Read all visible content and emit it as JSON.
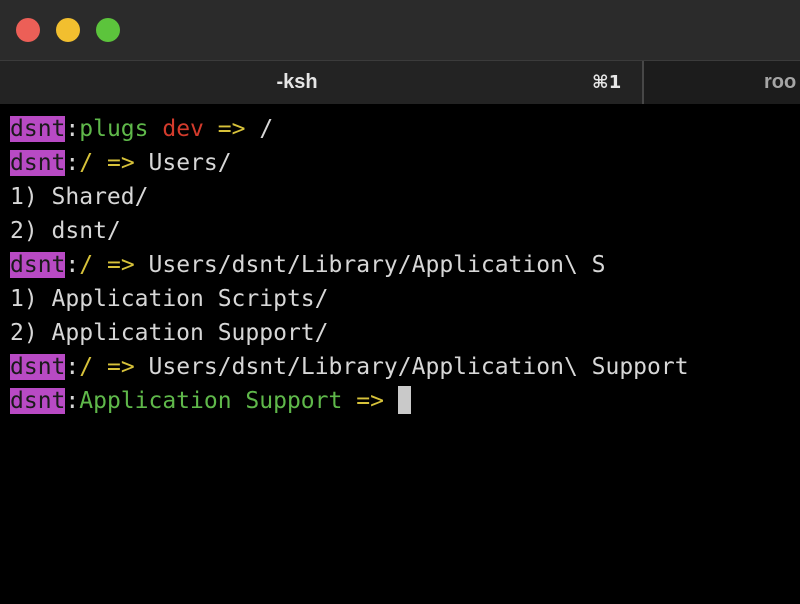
{
  "window": {
    "traffic_lights": {
      "close_color": "#ec5f57",
      "minimize_color": "#f2bf2f",
      "zoom_color": "#5cc43c"
    }
  },
  "tabs": [
    {
      "title": "-ksh",
      "shortcut": "⌘1",
      "active": true
    },
    {
      "title": "roo",
      "active": false
    }
  ],
  "terminal": {
    "colors": {
      "user_bg": "#b84ac4",
      "path": "#5fb84a",
      "branch": "#d33b2c",
      "arrow": "#d7c23a",
      "text": "#d7d7d7"
    },
    "lines": [
      {
        "user": "dsnt",
        "colon": ":",
        "path": "plugs",
        "branch": "dev",
        "arrow": "=>",
        "command": "/"
      },
      {
        "user": "dsnt",
        "colon": ":",
        "path": "/",
        "arrow": "=>",
        "command": "Users/"
      },
      {
        "text": "1) Shared/"
      },
      {
        "text": "2) dsnt/"
      },
      {
        "user": "dsnt",
        "colon": ":",
        "path": "/",
        "arrow": "=>",
        "command": "Users/dsnt/Library/Application\\ S"
      },
      {
        "text": "1) Application Scripts/"
      },
      {
        "text": "2) Application Support/"
      },
      {
        "user": "dsnt",
        "colon": ":",
        "path": "/",
        "arrow": "=>",
        "command": "Users/dsnt/Library/Application\\ Support"
      },
      {
        "user": "dsnt",
        "colon": ":",
        "path": "Application Support",
        "arrow": "=>",
        "command": ""
      }
    ]
  }
}
